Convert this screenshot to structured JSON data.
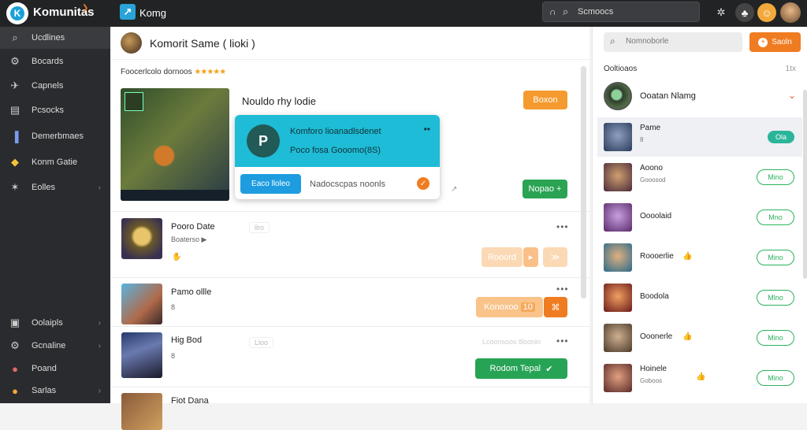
{
  "app": {
    "title": "Komunitas",
    "channel": "Komg"
  },
  "top_search": {
    "placeholder": "Scmoocs"
  },
  "sidebar": {
    "items": [
      {
        "label": "Ucdlines",
        "icon": "search-icon"
      },
      {
        "label": "Bocards",
        "icon": "gear-icon"
      },
      {
        "label": "Capnels",
        "icon": "fire-icon"
      },
      {
        "label": "Pcsocks",
        "icon": "list-icon"
      },
      {
        "label": "Demerbmaes",
        "icon": "book-icon"
      },
      {
        "label": "Konm Gatie",
        "icon": "game-icon"
      },
      {
        "label": "Eolles",
        "icon": "star-icon"
      }
    ],
    "bottom_items": [
      {
        "label": "Oolaipls",
        "icon": "image-icon"
      },
      {
        "label": "Gcnaline",
        "icon": "gear-icon"
      },
      {
        "label": "Poand",
        "icon": "avatar-icon"
      },
      {
        "label": "Sarlas",
        "icon": "avatar-icon"
      }
    ]
  },
  "channel_header": {
    "title": "Komorit Same ( lioki )"
  },
  "subtitle": {
    "text": "Foocerlcolo dornoos",
    "stars": "★★★★★"
  },
  "featured": {
    "title": "Nouldo rhy lodie",
    "tag_button": "Boxon",
    "cta_button": "Nopao",
    "cta_icon": "+"
  },
  "popup": {
    "line1": "Komforo lioanadlsdenet",
    "dots": "••",
    "line2": "Poco fosa Gooomo(8S)",
    "button": "Eaco lloleo",
    "link": "Nadocscpas noonls",
    "icon": "✓"
  },
  "posts": [
    {
      "title": "Pooro Date",
      "meta": "Boaterso ▶",
      "chip": "llro",
      "button": "Rooord",
      "button2": "≫",
      "dots": "•••"
    },
    {
      "title": "Pamo ollle",
      "meta": "8",
      "button": "Konoxoo",
      "button_tag": "10",
      "dots": "•••"
    },
    {
      "title": "Hig Bod",
      "meta": "8",
      "chip": "Lloo",
      "faded": "Lcoonsoos llloonin",
      "button": "Rodom Tepal",
      "dots": "•••"
    },
    {
      "title": "Fiot Dana"
    }
  ],
  "right": {
    "search_placeholder": "Nomnoborle",
    "search_button": "Saoln",
    "section_label": "Ooltioaos",
    "section_count": "1tx",
    "community": {
      "name": "Ooatan Nlamg"
    },
    "friends": [
      {
        "name": "Pame",
        "status": "8",
        "button": "Ola",
        "selected": true
      },
      {
        "name": "Aoono",
        "status": "Gooosod",
        "button": "Mino"
      },
      {
        "name": "Oooolaid",
        "status": "",
        "button": "Mno"
      },
      {
        "name": "Roooerlie",
        "status": "",
        "button": "Mino",
        "emoji": "👍"
      },
      {
        "name": "Boodola",
        "status": "",
        "button": "Mlno"
      },
      {
        "name": "Ooonerle",
        "status": "",
        "button": "Mino",
        "emoji": "👍"
      },
      {
        "name": "Hoinele",
        "status": "Goboos",
        "button": "Mino",
        "emoji": "👍"
      }
    ]
  },
  "colors": {
    "accent_orange": "#f07c22",
    "accent_green": "#2bb35d",
    "accent_cyan": "#1ebcd6",
    "sidebar_bg": "#2a2b2e"
  }
}
